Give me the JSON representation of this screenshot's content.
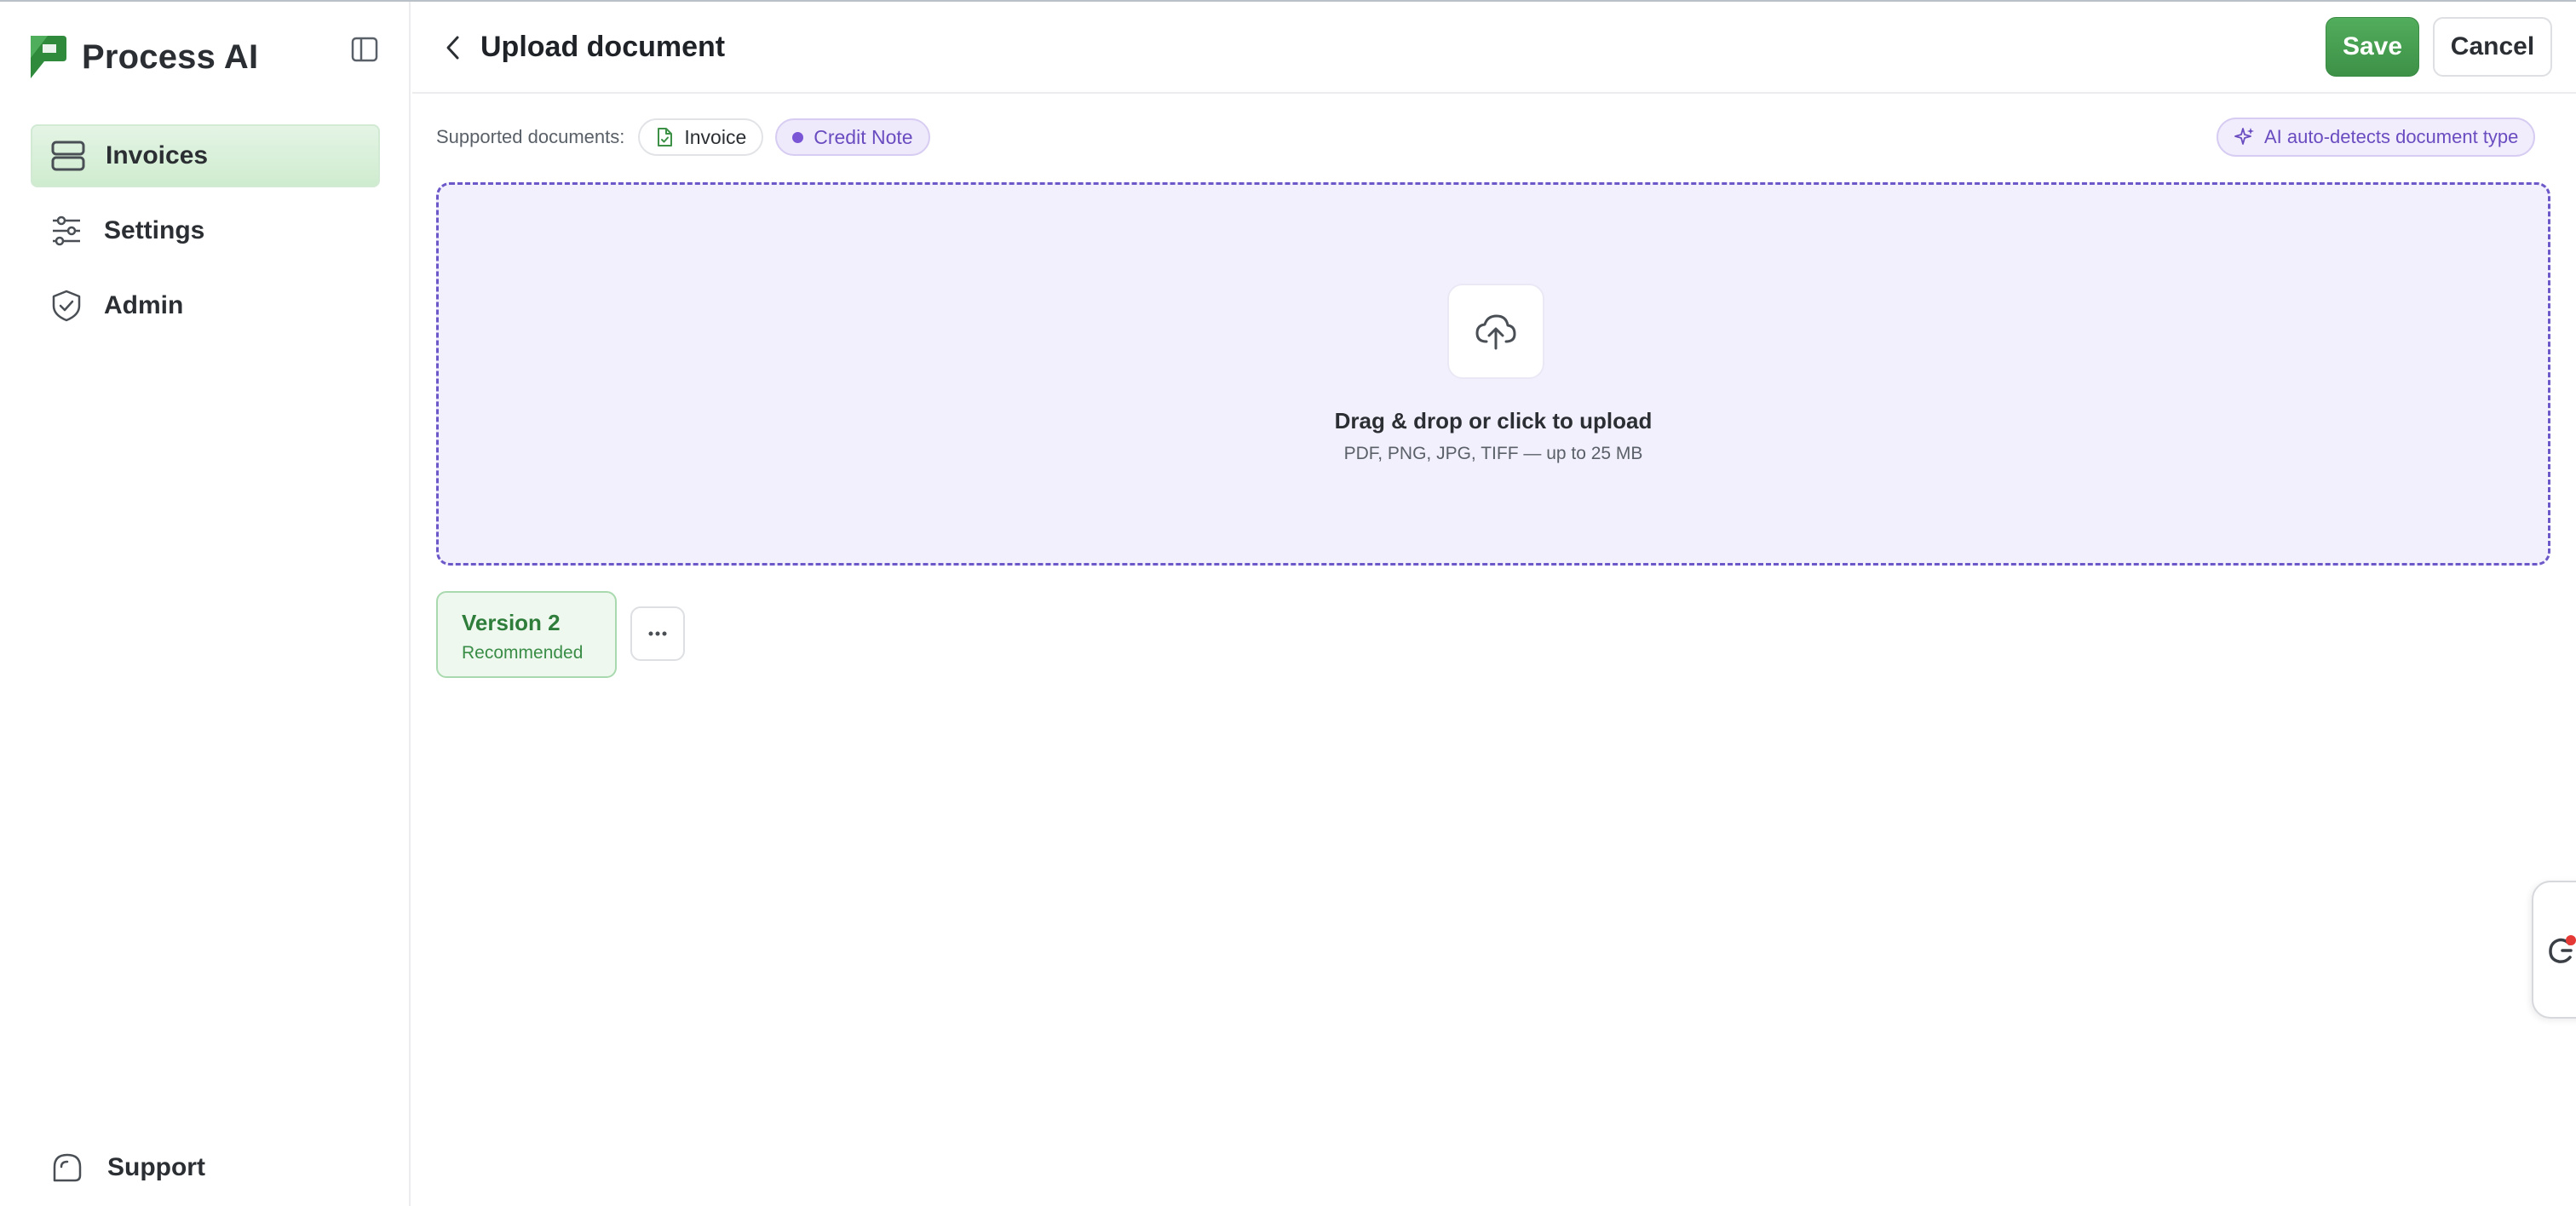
{
  "app": {
    "name": "Process AI",
    "accent": "#4a9f55",
    "brand_color": "#2e7d3a",
    "ai_color": "#6a4cc1"
  },
  "sidebar": {
    "items": [
      {
        "label": "Invoices",
        "icon": "stack-icon",
        "active": true
      },
      {
        "label": "Settings",
        "icon": "sliders-icon",
        "active": false
      },
      {
        "label": "Admin",
        "icon": "shield-check-icon",
        "active": false
      }
    ],
    "support_label": "Support"
  },
  "header": {
    "title": "Upload document",
    "save_label": "Save",
    "cancel_label": "Cancel"
  },
  "supported": {
    "label": "Supported documents:",
    "chips": [
      {
        "label": "Invoice",
        "icon": "file-check-icon"
      },
      {
        "label": "Credit Note",
        "icon": "dot-icon"
      }
    ],
    "ai_label": "AI auto-detects document type"
  },
  "dropzone": {
    "icon": "cloud-upload-icon",
    "title": "Drag & drop or click to upload",
    "subtitle": "PDF, PNG, JPG, TIFF — up to 25 MB"
  },
  "version": {
    "title": "Version 2",
    "subtitle": "Recommended"
  }
}
